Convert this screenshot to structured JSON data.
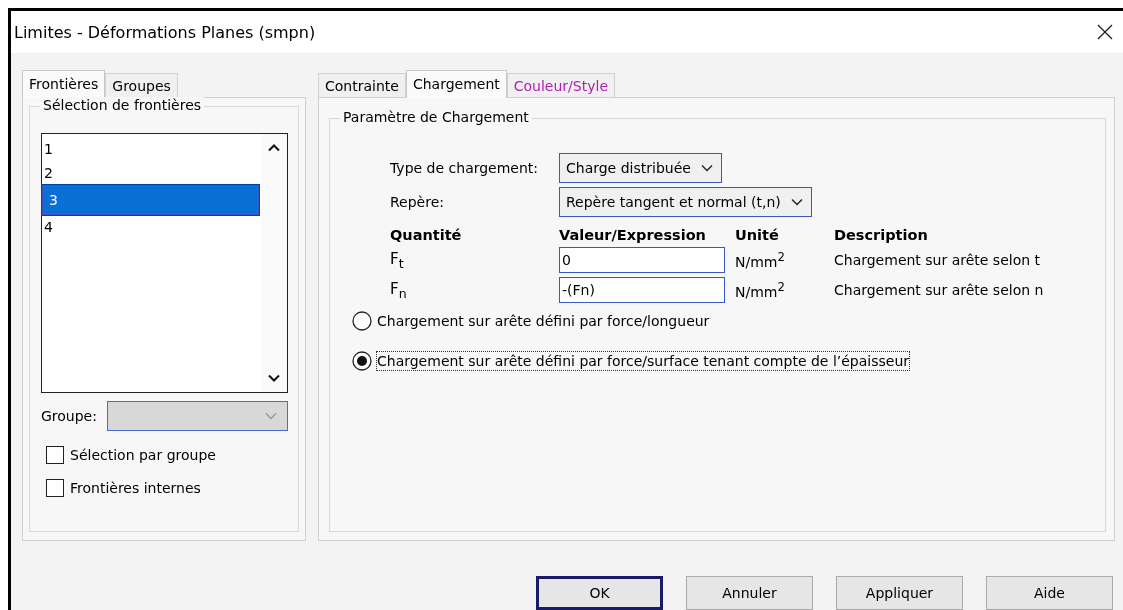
{
  "window": {
    "title": "Limites - Déformations Planes (smpn)"
  },
  "left_tabs": [
    {
      "label": "Frontières",
      "selected": true
    },
    {
      "label": "Groupes",
      "selected": false
    }
  ],
  "boundary_selection": {
    "title": "Sélection de frontières",
    "items": [
      {
        "label": "1",
        "selected": false
      },
      {
        "label": "2",
        "selected": false
      },
      {
        "label": "3",
        "selected": true
      },
      {
        "label": "4",
        "selected": false
      }
    ],
    "group_label": "Groupe:",
    "group_disabled": true,
    "checkboxes": [
      {
        "label": "Sélection par groupe",
        "checked": false
      },
      {
        "label": "Frontières internes",
        "checked": false
      }
    ]
  },
  "right_tabs": [
    {
      "label": "Contrainte",
      "selected": false,
      "color": "#000000"
    },
    {
      "label": "Chargement",
      "selected": true,
      "color": "#000000"
    },
    {
      "label": "Couleur/Style",
      "selected": false,
      "color": "#b020b0"
    }
  ],
  "loading": {
    "title": "Paramètre de Chargement",
    "type_label": "Type de chargement:",
    "type_value": "Charge distribuée",
    "frame_label": "Repère:",
    "frame_value": "Repère tangent et normal (t,n)",
    "headers": [
      "Quantité",
      "Valeur/Expression",
      "Unité",
      "Description"
    ],
    "rows": [
      {
        "quantity": "F$_{t}$",
        "value": "0",
        "unit": "N/mm$^{2}$",
        "description": "Chargement sur arête selon t"
      },
      {
        "quantity": "F$_{n}$",
        "value": "-(Fn)",
        "unit": "N/mm$^{2}$",
        "description": "Chargement sur arête selon n"
      }
    ],
    "options": [
      {
        "label": "Chargement sur arête défini par force/longueur",
        "selected": false,
        "focused": false
      },
      {
        "label": "Chargement sur arête défini par force/surface tenant compte de l’épaisseur",
        "selected": true,
        "focused": true
      }
    ]
  },
  "buttons": [
    {
      "label": "OK",
      "default": true
    },
    {
      "label": "Annuler",
      "default": false
    },
    {
      "label": "Appliquer",
      "default": false
    },
    {
      "label": "Aide",
      "default": false
    }
  ]
}
